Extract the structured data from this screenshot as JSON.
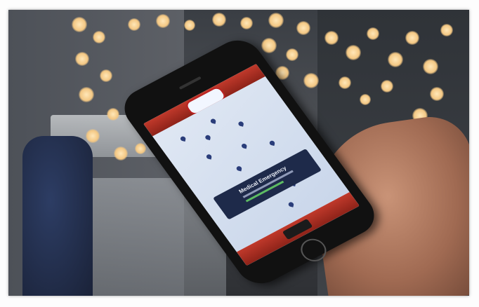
{
  "photo": {
    "subject": "hand holding smartphone showing map app",
    "popup_title": "Medical Emergency"
  },
  "colors": {
    "app_bar": "#c0392b",
    "map": "#dfe7f3",
    "popup": "#1e2a4a",
    "bokeh": "#f3c783"
  }
}
